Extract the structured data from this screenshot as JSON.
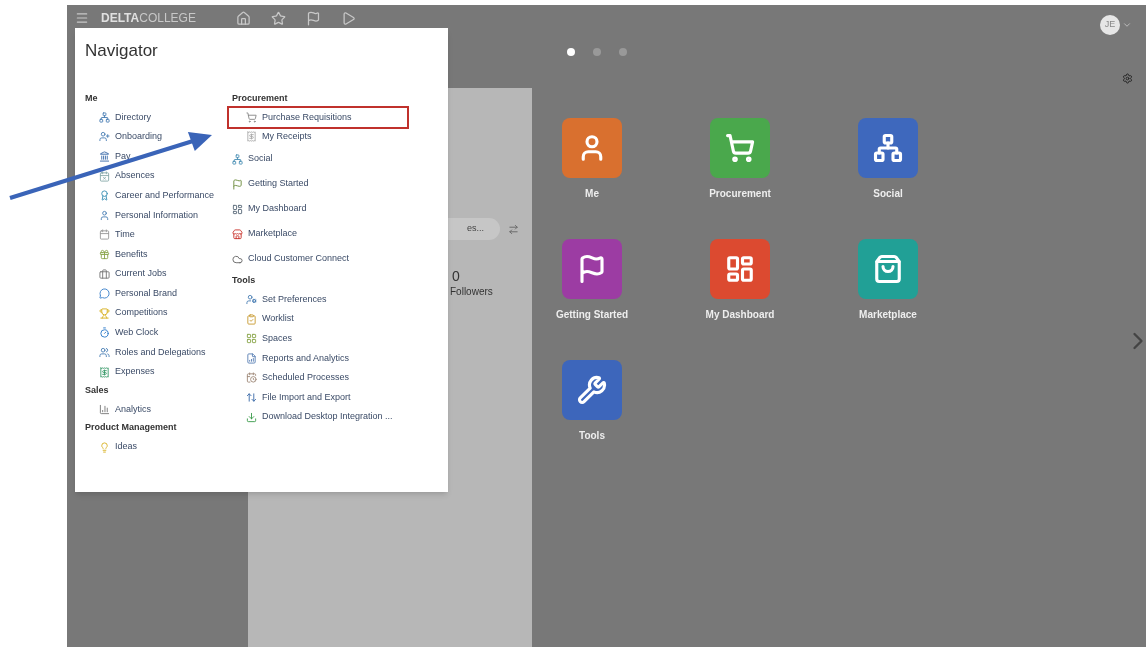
{
  "header": {
    "brand_bold": "DELTA",
    "brand_rest": "COLLEGE",
    "avatar": "JE"
  },
  "navigator": {
    "title": "Navigator",
    "columns": [
      {
        "sections": [
          {
            "heading": "Me",
            "items": [
              {
                "label": "Directory",
                "highlighted": false
              },
              {
                "label": "Onboarding",
                "highlighted": false
              },
              {
                "label": "Pay",
                "highlighted": false
              },
              {
                "label": "Absences",
                "highlighted": false
              },
              {
                "label": "Career and Performance",
                "highlighted": false
              },
              {
                "label": "Personal Information",
                "highlighted": false
              },
              {
                "label": "Time",
                "highlighted": false
              },
              {
                "label": "Benefits",
                "highlighted": false
              },
              {
                "label": "Current Jobs",
                "highlighted": false
              },
              {
                "label": "Personal Brand",
                "highlighted": false
              },
              {
                "label": "Competitions",
                "highlighted": false
              },
              {
                "label": "Web Clock",
                "highlighted": false
              },
              {
                "label": "Roles and Delegations",
                "highlighted": false
              },
              {
                "label": "Expenses",
                "highlighted": false
              }
            ]
          },
          {
            "heading": "Sales",
            "items": [
              {
                "label": "Analytics",
                "highlighted": false
              }
            ]
          },
          {
            "heading": "Product Management",
            "items": [
              {
                "label": "Ideas",
                "highlighted": false
              }
            ]
          }
        ]
      },
      {
        "sections": [
          {
            "heading": "Procurement",
            "items": [
              {
                "label": "Purchase Requisitions",
                "highlighted": true
              },
              {
                "label": "My Receipts",
                "highlighted": false
              }
            ]
          },
          {
            "items": [
              {
                "label": "Social",
                "highlighted": false
              },
              {
                "label": "Getting Started",
                "highlighted": false
              },
              {
                "label": "My Dashboard",
                "highlighted": false
              },
              {
                "label": "Marketplace",
                "highlighted": false
              },
              {
                "label": "Cloud Customer Connect",
                "highlighted": false
              }
            ]
          },
          {
            "heading": "Tools",
            "items": [
              {
                "label": "Set Preferences",
                "highlighted": false
              },
              {
                "label": "Worklist",
                "highlighted": false
              },
              {
                "label": "Spaces",
                "highlighted": false
              },
              {
                "label": "Reports and Analytics",
                "highlighted": false
              },
              {
                "label": "Scheduled Processes",
                "highlighted": false
              },
              {
                "label": "File Import and Export",
                "highlighted": false
              },
              {
                "label": "Download Desktop Integration ...",
                "highlighted": false
              }
            ]
          }
        ]
      }
    ]
  },
  "background_panel": {
    "search_value": "es...",
    "followers_count": "0",
    "followers_label": "Followers"
  },
  "pages": [
    {
      "selected": true
    },
    {
      "selected": false
    },
    {
      "selected": false
    }
  ],
  "tiles": [
    {
      "label": "Me",
      "color": "#d9702f"
    },
    {
      "label": "Procurement",
      "color": "#4aa84c"
    },
    {
      "label": "Social",
      "color": "#3e68bd"
    },
    {
      "label": "Getting Started",
      "color": "#9c3ca3"
    },
    {
      "label": "My Dashboard",
      "color": "#dc4a30"
    },
    {
      "label": "Marketplace",
      "color": "#21a096"
    },
    {
      "label": "Tools",
      "color": "#3d66bb"
    }
  ]
}
